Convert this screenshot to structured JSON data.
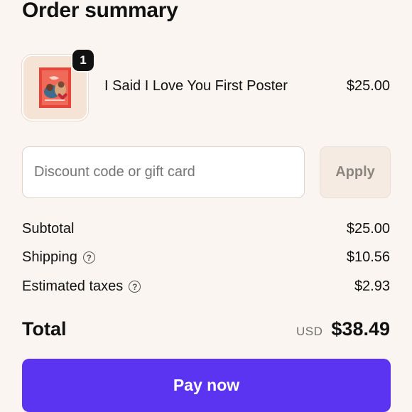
{
  "page": {
    "title": "Order summary",
    "accent_color": "#5b34f2",
    "background_color": "#faf5f0"
  },
  "product": {
    "name": "I Said I Love You First Poster",
    "price": "$25.00",
    "quantity": "1",
    "thumbnail_icon": "poster-thumbnail"
  },
  "discount": {
    "placeholder": "Discount code or gift card",
    "value": "",
    "apply_label": "Apply"
  },
  "summary": {
    "subtotal_label": "Subtotal",
    "subtotal_value": "$25.00",
    "shipping_label": "Shipping",
    "shipping_value": "$10.56",
    "taxes_label": "Estimated taxes",
    "taxes_value": "$2.93",
    "help_icon": "?",
    "total_label": "Total",
    "currency": "USD",
    "total_value": "$38.49"
  },
  "checkout": {
    "pay_label": "Pay now"
  }
}
